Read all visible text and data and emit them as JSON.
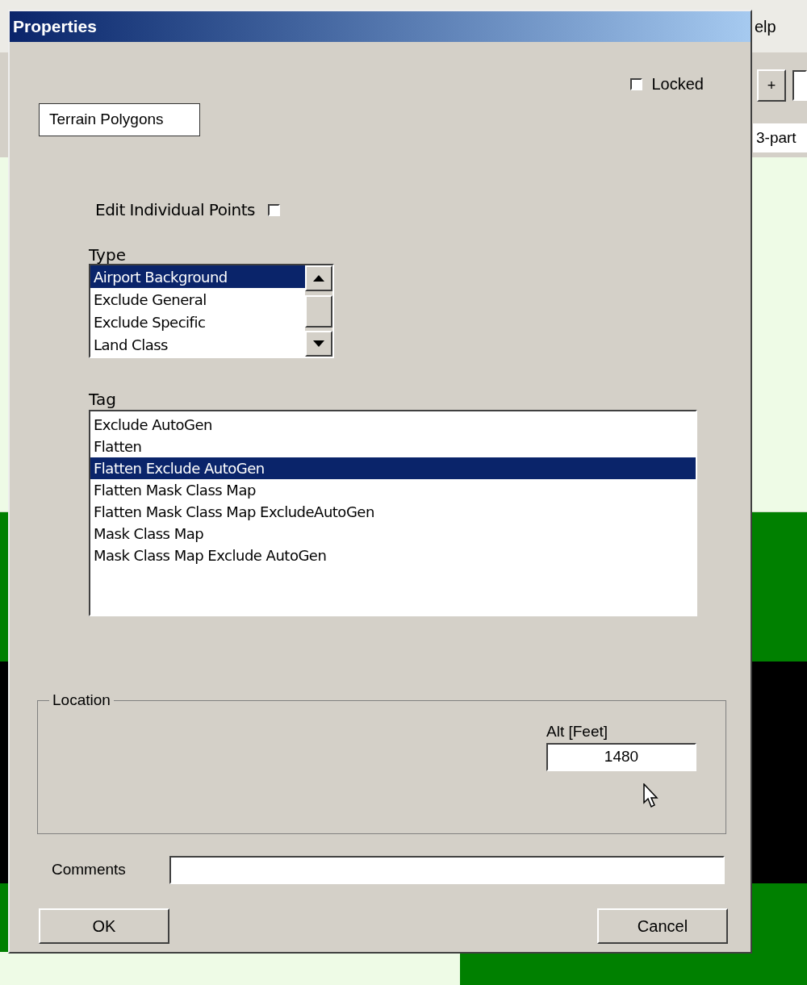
{
  "background_app": {
    "menu_fragment": "elp",
    "toolbar_button": "+",
    "field_fragment": "3-part"
  },
  "dialog": {
    "title": "Properties",
    "locked": {
      "label": "Locked",
      "checked": false
    },
    "name_field": {
      "value": "Terrain Polygons"
    },
    "edit_points": {
      "label": "Edit Individual Points",
      "checked": false
    },
    "type": {
      "label": "Type",
      "items": [
        {
          "label": "Airport Background",
          "selected": true
        },
        {
          "label": "Exclude General",
          "selected": false
        },
        {
          "label": "Exclude Specific",
          "selected": false
        },
        {
          "label": "Land Class",
          "selected": false
        }
      ]
    },
    "tag": {
      "label": "Tag",
      "items": [
        {
          "label": "Exclude AutoGen",
          "selected": false
        },
        {
          "label": "Flatten",
          "selected": false
        },
        {
          "label": "Flatten Exclude AutoGen",
          "selected": true
        },
        {
          "label": "Flatten Mask Class Map",
          "selected": false
        },
        {
          "label": "Flatten Mask Class Map ExcludeAutoGen",
          "selected": false
        },
        {
          "label": "Mask Class Map",
          "selected": false
        },
        {
          "label": "Mask Class Map Exclude AutoGen",
          "selected": false
        }
      ]
    },
    "location": {
      "label": "Location",
      "alt_label": "Alt [Feet]",
      "alt_value": "1480"
    },
    "comments": {
      "label": "Comments"
    },
    "buttons": [
      "OK",
      "Cancel"
    ]
  }
}
